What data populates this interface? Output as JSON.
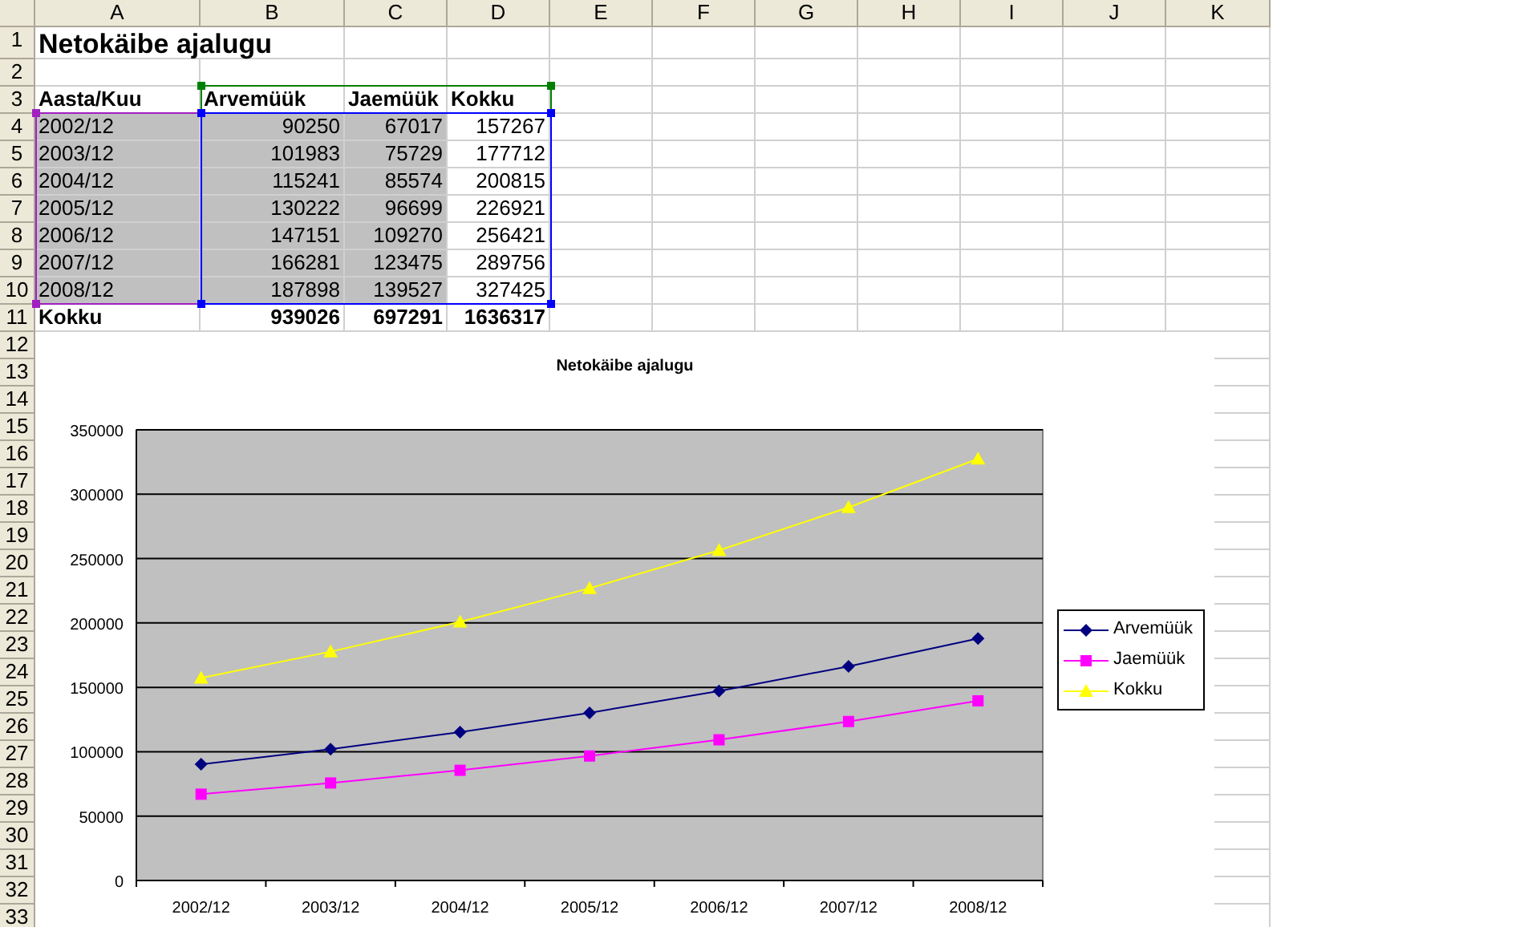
{
  "sheet": {
    "columns": [
      "A",
      "B",
      "C",
      "D",
      "E",
      "F",
      "G",
      "H",
      "I",
      "J",
      "K"
    ],
    "row_numbers": [
      "1",
      "2",
      "3",
      "4",
      "5",
      "6",
      "7",
      "8",
      "9",
      "10",
      "11",
      "12",
      "13",
      "14",
      "15",
      "16",
      "17",
      "18",
      "19",
      "20",
      "21",
      "22",
      "23",
      "24",
      "25",
      "26",
      "27",
      "28",
      "29",
      "30",
      "31",
      "32",
      "33"
    ],
    "title": "Netokäibe ajalugu",
    "header": [
      "Aasta/Kuu",
      "Arvemüük",
      "Jaemüük",
      "Kokku"
    ],
    "rows": [
      {
        "cells": [
          "2002/12",
          "90250",
          "67017",
          "157267"
        ],
        "selected": [
          true,
          true,
          true,
          false
        ]
      },
      {
        "cells": [
          "2003/12",
          "101983",
          "75729",
          "177712"
        ],
        "selected": [
          true,
          true,
          true,
          false
        ]
      },
      {
        "cells": [
          "2004/12",
          "115241",
          "85574",
          "200815"
        ],
        "selected": [
          true,
          true,
          true,
          false
        ]
      },
      {
        "cells": [
          "2005/12",
          "130222",
          "96699",
          "226921"
        ],
        "selected": [
          true,
          true,
          true,
          false
        ]
      },
      {
        "cells": [
          "2006/12",
          "147151",
          "109270",
          "256421"
        ],
        "selected": [
          true,
          true,
          true,
          false
        ]
      },
      {
        "cells": [
          "2007/12",
          "166281",
          "123475",
          "289756"
        ],
        "selected": [
          true,
          true,
          true,
          false
        ]
      },
      {
        "cells": [
          "2008/12",
          "187898",
          "139527",
          "327425"
        ],
        "selected": [
          true,
          true,
          true,
          false
        ]
      }
    ],
    "total": [
      "Kokku",
      "939026",
      "697291",
      "1636317"
    ]
  },
  "chart": {
    "chart_data": {
      "type": "line",
      "title": "Netokäibe ajalugu",
      "categories": [
        "2002/12",
        "2003/12",
        "2004/12",
        "2005/12",
        "2006/12",
        "2007/12",
        "2008/12"
      ],
      "series": [
        {
          "name": "Arvemüük",
          "color": "#000080",
          "marker": "diamond",
          "values": [
            90250,
            101983,
            115241,
            130222,
            147151,
            166281,
            187898
          ]
        },
        {
          "name": "Jaemüük",
          "color": "#ff00ff",
          "marker": "square",
          "values": [
            67017,
            75729,
            85574,
            96699,
            109270,
            123475,
            139527
          ]
        },
        {
          "name": "Kokku",
          "color": "#ffff00",
          "marker": "triangle",
          "values": [
            157267,
            177712,
            200815,
            226921,
            256421,
            289756,
            327425
          ]
        }
      ],
      "grid": true,
      "ylim": [
        0,
        350000
      ],
      "yticks": [
        0,
        50000,
        100000,
        150000,
        200000,
        250000,
        300000,
        350000
      ]
    }
  }
}
